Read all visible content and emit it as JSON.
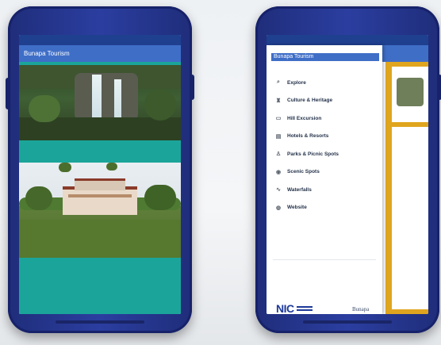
{
  "colors": {
    "appbar": "#3f6ec7",
    "teal": "#1ba59a",
    "phone": "#2b3ea0",
    "accent": "#e0a51e"
  },
  "left_phone": {
    "status_left": "",
    "status_right": "",
    "appbar_title": "Bunapa Tourism",
    "waterfall_caption": "",
    "palace_caption_left": "",
    "palace_caption_right": ""
  },
  "right_phone": {
    "drawer_title": "Bunapa Tourism",
    "drawer_subtitle": "",
    "menu": [
      {
        "icon": "search-icon",
        "glyph": "⌕",
        "label": "Explore"
      },
      {
        "icon": "heritage-icon",
        "glyph": "♜",
        "label": "Culture & Heritage"
      },
      {
        "icon": "hill-icon",
        "glyph": "▭",
        "label": "Hill Excursion"
      },
      {
        "icon": "hotel-icon",
        "glyph": "▤",
        "label": "Hotels & Resorts"
      },
      {
        "icon": "park-icon",
        "glyph": "♙",
        "label": "Parks & Picnic Spots"
      },
      {
        "icon": "camera-icon",
        "glyph": "◉",
        "label": "Scenic Spots"
      },
      {
        "icon": "waterfall-icon",
        "glyph": "∿",
        "label": "Waterfalls"
      },
      {
        "icon": "globe-icon",
        "glyph": "◍",
        "label": "Website"
      }
    ],
    "supported_label": "",
    "nic_logo": "NIC",
    "gov_logo": "Bunapa"
  }
}
